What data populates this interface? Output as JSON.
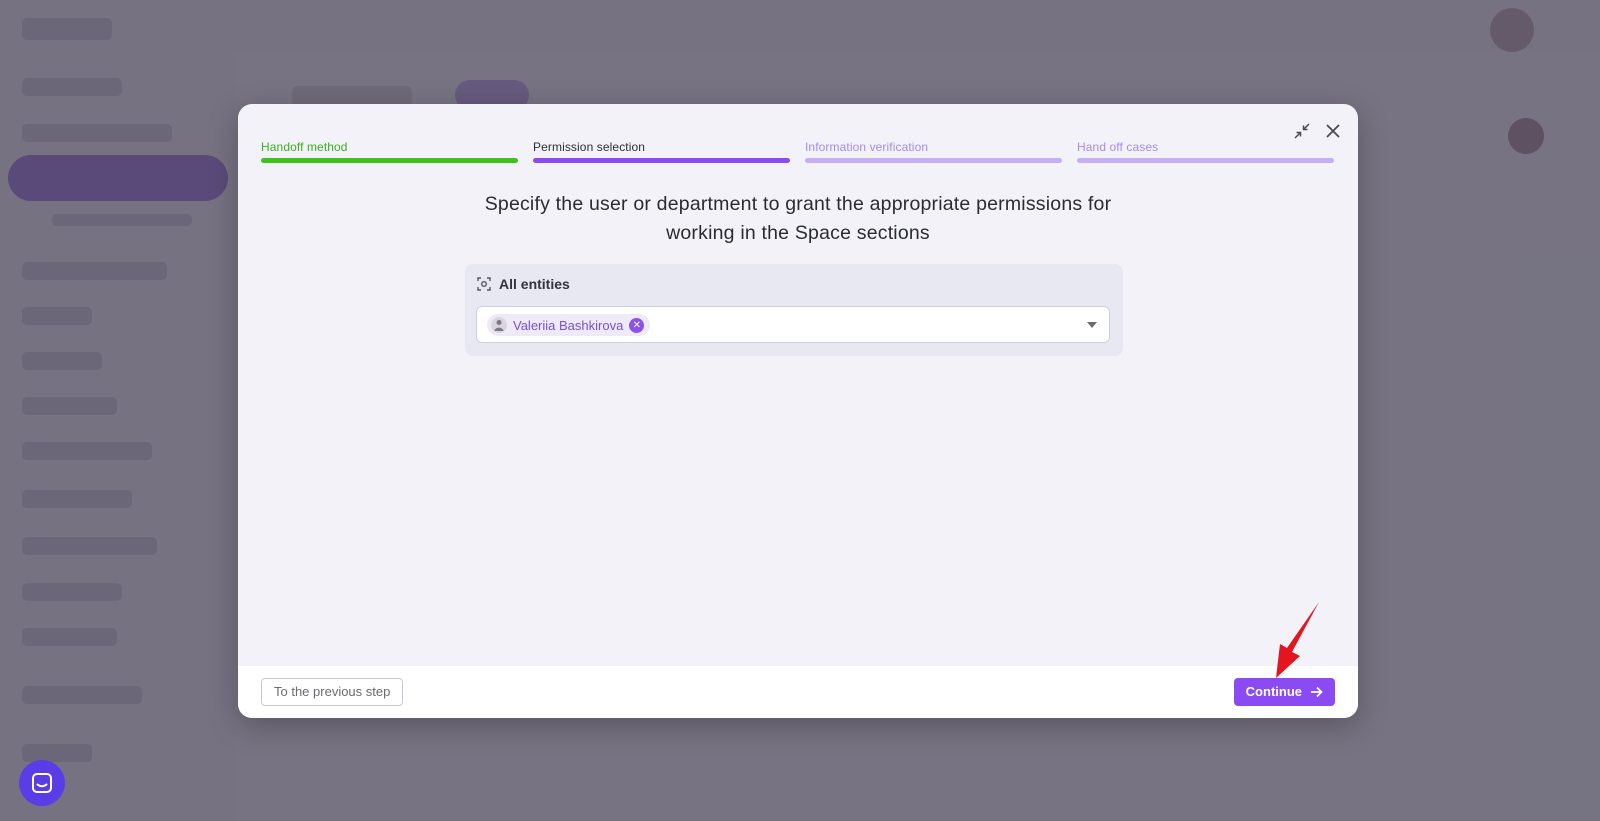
{
  "steps": [
    {
      "label": "Handoff method",
      "text_color": "#3bb01f",
      "bar_color": "#3ec21c"
    },
    {
      "label": "Permission selection",
      "text_color": "#2d2d35",
      "bar_color": "#8a4cf2"
    },
    {
      "label": "Information verification",
      "text_color": "#a98bea",
      "bar_color": "#c5aff5"
    },
    {
      "label": "Hand off cases",
      "text_color": "#a98bea",
      "bar_color": "#c5aff5"
    }
  ],
  "modal": {
    "title_line1": "Specify the user or department to grant the appropriate permissions for",
    "title_line2": "working in the Space sections",
    "controls": {
      "minimize_icon": "collapse-arrows-icon",
      "close_icon": "close-icon"
    }
  },
  "entities": {
    "heading": "All entities",
    "heading_icon": "scan-focus-icon",
    "selected": [
      {
        "name": "Valeriia Bashkirova",
        "avatar_icon": "user-avatar-icon",
        "remove_icon": "remove-x-icon"
      }
    ],
    "dropdown_icon": "caret-down-icon"
  },
  "footer": {
    "prev_label": "To the previous step",
    "continue_label": "Continue",
    "continue_icon": "arrow-right-icon"
  },
  "colors": {
    "accent": "#8a4cf2",
    "success": "#3ec21c",
    "overlay": "#4d4858",
    "annotation_arrow": "#e4151f"
  },
  "chat_widget": {
    "icon": "chat-icon"
  }
}
